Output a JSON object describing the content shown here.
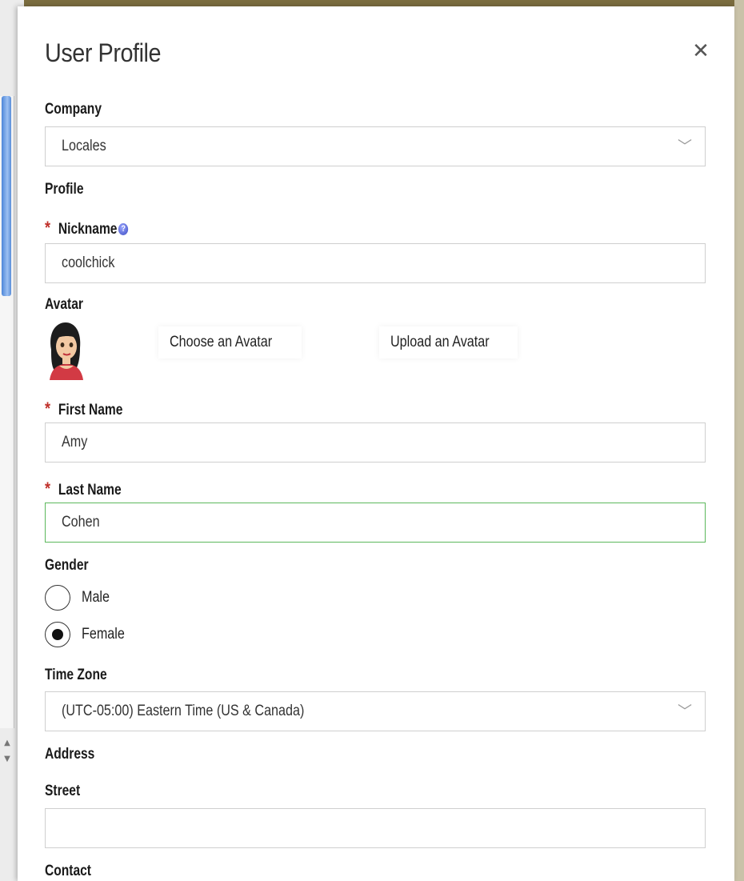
{
  "dialog": {
    "title": "User Profile",
    "close_icon": "close-icon"
  },
  "company": {
    "label": "Company",
    "value": "Locales"
  },
  "profile": {
    "section_label": "Profile",
    "nickname": {
      "label": "Nickname",
      "required": true,
      "value": "coolchick"
    },
    "avatar": {
      "label": "Avatar",
      "choose_label": "Choose an Avatar",
      "upload_label": "Upload an Avatar"
    },
    "first_name": {
      "label": "First Name",
      "required": true,
      "value": "Amy"
    },
    "last_name": {
      "label": "Last Name",
      "required": true,
      "value": "Cohen"
    },
    "gender": {
      "label": "Gender",
      "options": [
        {
          "label": "Male",
          "checked": false
        },
        {
          "label": "Female",
          "checked": true
        }
      ]
    },
    "time_zone": {
      "label": "Time Zone",
      "value": "(UTC-05:00) Eastern Time (US & Canada)"
    }
  },
  "address": {
    "section_label": "Address",
    "street": {
      "label": "Street",
      "value": ""
    }
  },
  "contact": {
    "section_label": "Contact"
  },
  "required_marker": "*",
  "colors": {
    "required": "#c0302a",
    "focus_border": "#5cb85c"
  }
}
